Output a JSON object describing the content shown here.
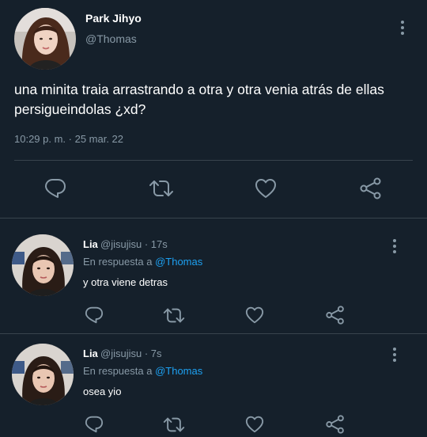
{
  "main_tweet": {
    "display_name": "Park Jihyo",
    "handle": "@Thomas",
    "text_line1": "una minita traia arrastrando a otra y otra venia atrás de ellas",
    "text_line2": "persigueindolas ¿xd?",
    "timestamp": "10:29 p. m. · 25 mar. 22"
  },
  "replies": [
    {
      "display_name": "Lia",
      "handle": "@jisujisu",
      "age": "· 17s",
      "in_reply_prefix": "En respuesta a",
      "in_reply_mention": "@Thomas",
      "text": "y otra viene detras"
    },
    {
      "display_name": "Lia",
      "handle": "@jisujisu",
      "age": "· 7s",
      "in_reply_prefix": "En respuesta a",
      "in_reply_mention": "@Thomas",
      "text": "osea yio"
    }
  ],
  "icons": {
    "reply": "reply-icon",
    "retweet": "retweet-icon",
    "like": "heart-icon",
    "share": "share-icon",
    "more": "more-vertical-icon"
  },
  "colors": {
    "background": "#15202b",
    "text": "#ffffff",
    "muted": "#8899a6",
    "link": "#1da1f2",
    "divider": "#38444d"
  }
}
